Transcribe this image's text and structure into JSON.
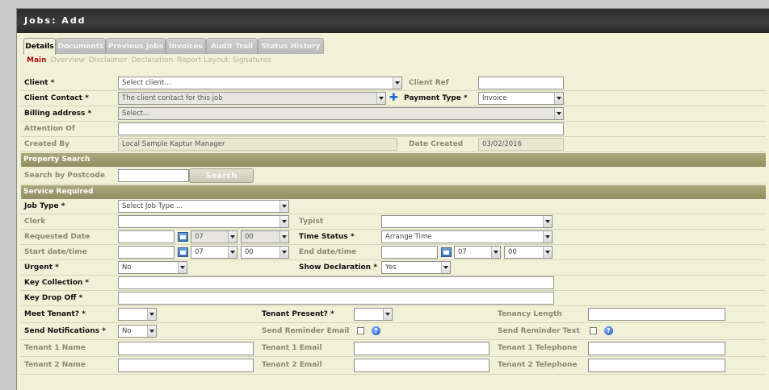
{
  "window": {
    "title": "Jobs: Add"
  },
  "tabs": [
    "Details",
    "Documents",
    "Previous Jobs",
    "Invoices",
    "Audit Trail",
    "Status History"
  ],
  "subtabs": [
    "Main",
    "Overview",
    "Disclaimer",
    "Declaration",
    "Report Layout",
    "Signatures"
  ],
  "client": {
    "label": "Client *",
    "value": "Select client...",
    "ref_label": "Client Ref",
    "ref_value": ""
  },
  "contact": {
    "label": "Client Contact *",
    "value": "The client contact for this job",
    "payment_label": "Payment Type *",
    "payment_value": "Invoice"
  },
  "billing": {
    "label": "Billing address *",
    "value": "Select..."
  },
  "attention": {
    "label": "Attention Of",
    "value": ""
  },
  "created": {
    "label": "Created By",
    "value": "Local Sample Kaptur Manager",
    "date_label": "Date Created",
    "date_value": "03/02/2016"
  },
  "property": {
    "section": "Property Search",
    "postcode_label": "Search by Postcode",
    "postcode_value": "",
    "search_button": "Search"
  },
  "service": {
    "section": "Service Required",
    "job_type_label": "Job Type *",
    "job_type_value": "Select Job Type ...",
    "clerk_label": "Clerk",
    "clerk_value": "",
    "typist_label": "Typist",
    "typist_value": "",
    "requested_label": "Requested Date",
    "requested_date": "",
    "requested_hour": "07",
    "requested_min": "00",
    "time_status_label": "Time Status *",
    "time_status_value": "Arrange Time",
    "start_label": "Start date/time",
    "start_date": "",
    "start_hour": "07",
    "start_min": "00",
    "end_label": "End date/time",
    "end_date": "",
    "end_hour": "07",
    "end_min": "00",
    "urgent_label": "Urgent *",
    "urgent_value": "No",
    "show_decl_label": "Show Declaration *",
    "show_decl_value": "Yes",
    "key_collection_label": "Key Collection *",
    "key_collection_value": "",
    "key_dropoff_label": "Key Drop Off *",
    "key_dropoff_value": "",
    "meet_label": "Meet Tenant? *",
    "meet_value": "",
    "present_label": "Tenant Present? *",
    "present_value": "",
    "tenancy_label": "Tenancy Length",
    "tenancy_value": "",
    "notif_label": "Send Notifications *",
    "notif_value": "No",
    "rem_email_label": "Send Reminder Email",
    "rem_text_label": "Send Reminder Text",
    "t1name_label": "Tenant 1 Name",
    "t1email_label": "Tenant 1 Email",
    "t1tel_label": "Tenant 1 Telephone",
    "t2name_label": "Tenant 2 Name",
    "t2email_label": "Tenant 2 Email",
    "t2tel_label": "Tenant 2 Telephone",
    "help_glyph": "?"
  },
  "colors": {
    "panel": "#f1f1d8",
    "section": "#9e9e72",
    "titlebar": "#2f2f2f",
    "active_subtab": "#b01010"
  }
}
